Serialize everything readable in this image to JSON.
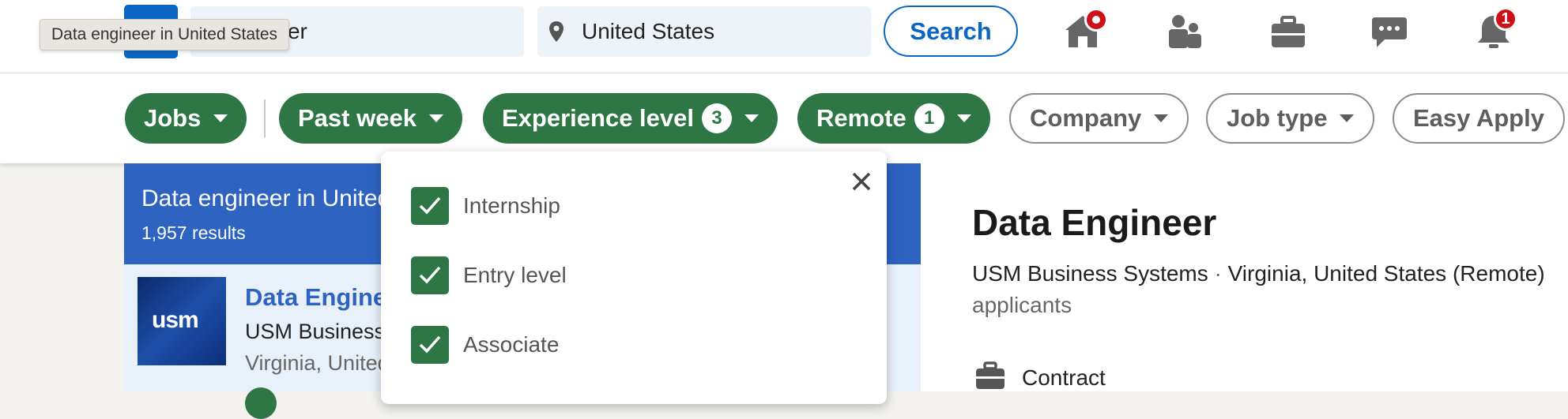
{
  "nav": {
    "search_value": "Data engineer",
    "search_visible": "gineer",
    "location_value": "United States",
    "search_button": "Search",
    "notifications_badge": "1"
  },
  "tooltip": "Data engineer in United States",
  "filters": {
    "jobs": "Jobs",
    "past_week": "Past week",
    "experience": "Experience level",
    "experience_count": "3",
    "remote": "Remote",
    "remote_count": "1",
    "company": "Company",
    "job_type": "Job type",
    "easy_apply": "Easy Apply"
  },
  "list": {
    "header_title": "Data engineer in United States",
    "result_count": "1,957 results",
    "item": {
      "title": "Data Engineer",
      "company": "USM Business Systems",
      "location": "Virginia, United States (Remote)",
      "logo_text": "usm"
    }
  },
  "detail": {
    "title": "Data Engineer",
    "company": "USM Business Systems",
    "separator": "·",
    "location": "Virginia, United States (Remote)",
    "applicants": "applicants",
    "job_type": "Contract"
  },
  "experience_dropdown": {
    "options": [
      {
        "label": "Internship",
        "checked": true
      },
      {
        "label": "Entry level",
        "checked": true
      },
      {
        "label": "Associate",
        "checked": true
      }
    ]
  },
  "colors": {
    "linkedin_blue": "#0a66c2",
    "filter_green": "#2e7745",
    "list_header_blue": "#2e63c2"
  }
}
